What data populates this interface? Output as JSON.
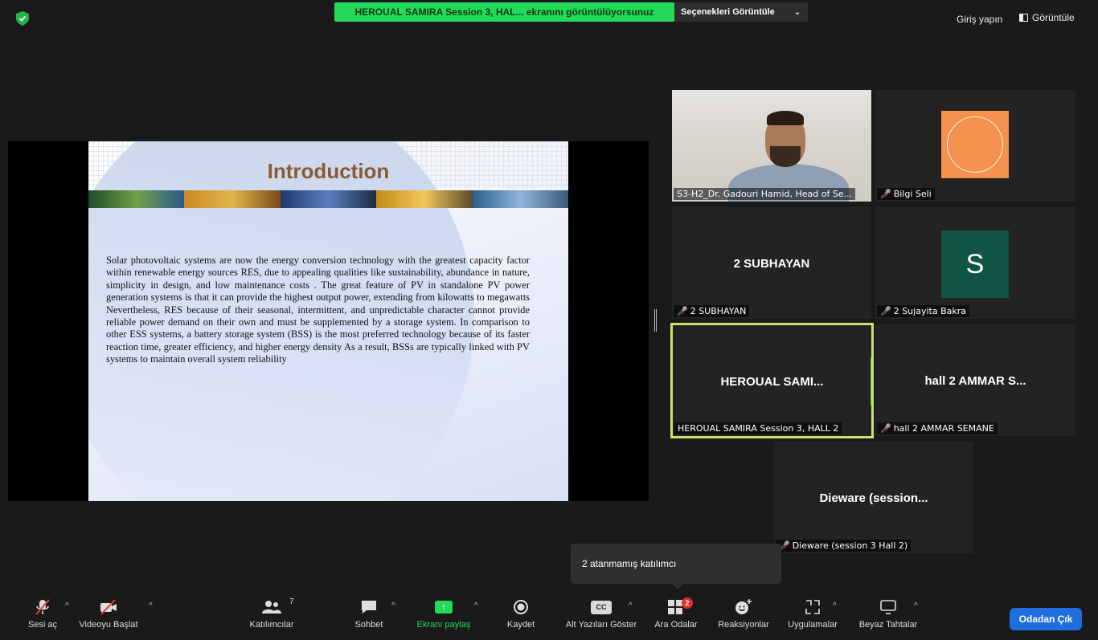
{
  "topbar": {
    "share_banner": "HEROUAL SAMIRA  Session 3, HAL... ekranını görüntülüyorsunuz",
    "view_options": "Seçenekleri Görüntüle",
    "sign_in": "Giriş yapın",
    "view": "Görüntüle"
  },
  "slide": {
    "title": "Introduction",
    "body": "Solar photovoltaic systems are now the energy conversion technology with the greatest capacity factor within renewable energy sources RES, due to appealing qualities like sustainability, abundance in nature, simplicity in design, and low maintenance costs . The great feature of PV in standalone PV power generation systems is that it can provide the highest output power, extending from kilowatts to megawatts  Nevertheless, RES because of their seasonal, intermittent, and unpredictable character cannot provide reliable power demand on their own and must be supplemented by a storage system.  In comparison to other ESS systems, a battery storage system (BSS) is the most preferred technology because of its faster reaction time, greater efficiency, and higher energy density As a result, BSSs are typically linked with PV systems to maintain overall system reliability"
  },
  "participants": {
    "p1_label": "S3-H2_Dr. Gadouri Hamid, Head of Se...",
    "p2_label": "Bilgi Seli",
    "p3_name": "2 SUBHAYAN",
    "p3_label": "2 SUBHAYAN",
    "p4_initial": "S",
    "p4_label": "2 Sujayita Bakra",
    "p5_name": "HEROUAL  SAMI...",
    "p5_label": "HEROUAL SAMIRA  Session 3, HALL 2",
    "p6_name": "hall 2 AMMAR S...",
    "p6_label": "hall 2 AMMAR SEMANE",
    "p7_name": "Dieware  (session...",
    "p7_label": "Dieware (session 3 Hall 2)"
  },
  "tooltip": "2 atanmamış katılımcı",
  "toolbar": {
    "unmute": "Sesi aç",
    "start_video": "Videoyu Başlat",
    "participants": "Katılımcılar",
    "participants_count": "7",
    "chat": "Sohbet",
    "share_screen": "Ekranı paylaş",
    "record": "Kaydet",
    "captions": "Alt Yazıları Göster",
    "cc": "CC",
    "breakout": "Ara Odalar",
    "breakout_badge": "2",
    "reactions": "Reaksiyonlar",
    "apps": "Uygulamalar",
    "whiteboards": "Beyaz Tahtalar",
    "leave": "Odadan Çık"
  },
  "colors": {
    "banner_green": "#23d959",
    "active_speaker_border": "#c8e36b",
    "leave_blue": "#1f6ee0",
    "muted_red": "#e03b3b"
  }
}
